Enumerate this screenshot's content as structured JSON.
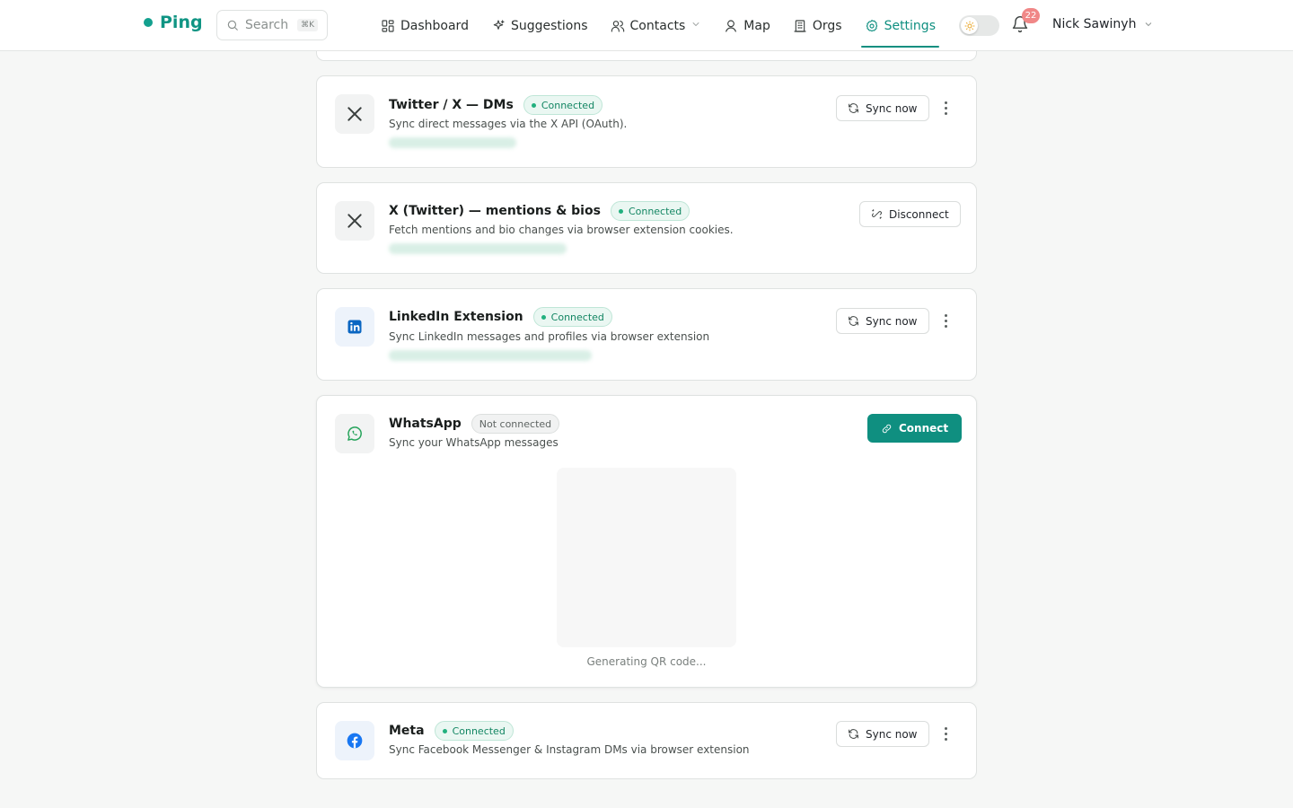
{
  "brand": {
    "name": "Ping"
  },
  "search": {
    "label": "Search",
    "shortcut": "⌘K"
  },
  "nav": {
    "items": [
      {
        "label": "Dashboard",
        "icon": "dashboard-icon"
      },
      {
        "label": "Suggestions",
        "icon": "sparkles-icon"
      },
      {
        "label": "Contacts",
        "icon": "users-icon"
      },
      {
        "label": "Map",
        "icon": "map-pin-icon"
      },
      {
        "label": "Orgs",
        "icon": "building-icon"
      },
      {
        "label": "Settings",
        "icon": "gear-icon"
      }
    ],
    "active": "Settings"
  },
  "notifications": {
    "count": "22"
  },
  "user": {
    "name": "Nick Sawinyh"
  },
  "integrations": [
    {
      "title": "Twitter / X — DMs",
      "status": "Connected",
      "description": "Sync direct messages via the X API (OAuth).",
      "action": "Sync now"
    },
    {
      "title": "X (Twitter) — mentions & bios",
      "status": "Connected",
      "description": "Fetch mentions and bio changes via browser extension cookies.",
      "action": "Disconnect"
    },
    {
      "title": "LinkedIn Extension",
      "status": "Connected",
      "description": "Sync LinkedIn messages and profiles via browser extension",
      "action": "Sync now"
    },
    {
      "title": "WhatsApp",
      "status": "Not connected",
      "description": "Sync your WhatsApp messages",
      "action": "Connect",
      "qr_caption": "Generating QR code..."
    },
    {
      "title": "Meta",
      "status": "Connected",
      "description": "Sync Facebook Messenger & Instagram DMs via browser extension",
      "action": "Sync now"
    }
  ],
  "colors": {
    "accent": "#0f8f80",
    "connected": "#138663",
    "badge": "#f08787"
  }
}
